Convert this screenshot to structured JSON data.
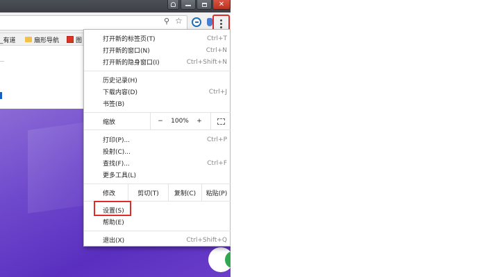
{
  "bookmarks": [
    {
      "label": "_有道",
      "icon": "none"
    },
    {
      "label": "扇形导航",
      "icon": "folder-icon"
    },
    {
      "label": "图",
      "icon": "red-square-icon"
    }
  ],
  "menu": {
    "group1": [
      {
        "label": "打开新的标签页(T)",
        "shortcut": "Ctrl+T"
      },
      {
        "label": "打开新的窗口(N)",
        "shortcut": "Ctrl+N"
      },
      {
        "label": "打开新的隐身窗口(I)",
        "shortcut": "Ctrl+Shift+N"
      }
    ],
    "group2": [
      {
        "label": "历史记录(H)",
        "shortcut": ""
      },
      {
        "label": "下载内容(D)",
        "shortcut": "Ctrl+J"
      },
      {
        "label": "书签(B)",
        "shortcut": ""
      }
    ],
    "zoom": {
      "label": "缩放",
      "minus": "−",
      "value": "100%",
      "plus": "+",
      "fullscreen_icon": "fullscreen-icon"
    },
    "group3": [
      {
        "label": "打印(P)...",
        "shortcut": "Ctrl+P"
      },
      {
        "label": "投射(C)...",
        "shortcut": ""
      },
      {
        "label": "查找(F)...",
        "shortcut": "Ctrl+F"
      },
      {
        "label": "更多工具(L)",
        "shortcut": ""
      }
    ],
    "edit": {
      "label": "修改",
      "cut": "剪切(T)",
      "copy": "复制(C)",
      "paste": "粘贴(P)"
    },
    "group4": [
      {
        "label": "设置(S)",
        "shortcut": ""
      },
      {
        "label": "帮助(E)",
        "shortcut": ""
      }
    ],
    "exit": {
      "label": "退出(X)",
      "shortcut": "Ctrl+Shift+Q"
    }
  },
  "colors": {
    "highlight": "#e02b2b",
    "page_purple": "#5a2fc0"
  }
}
